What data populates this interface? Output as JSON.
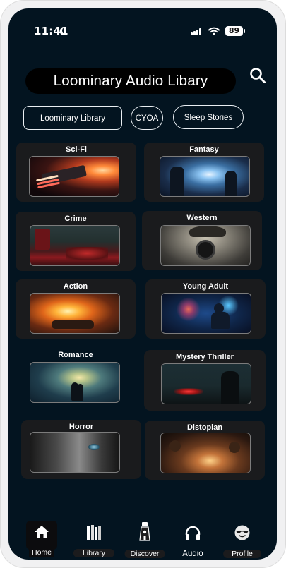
{
  "status_bar": {
    "time": "11:41",
    "battery": "89"
  },
  "header": {
    "title": "Loominary Audio Libary"
  },
  "tabs": [
    {
      "label": "Loominary Library"
    },
    {
      "label": "CYOA"
    },
    {
      "label": "Sleep Stories"
    }
  ],
  "genres": [
    {
      "label": "Sci-Fi"
    },
    {
      "label": "Fantasy"
    },
    {
      "label": "Crime"
    },
    {
      "label": "Western"
    },
    {
      "label": "Action"
    },
    {
      "label": "Young Adult"
    },
    {
      "label": "Romance"
    },
    {
      "label": "Mystery Thriller"
    },
    {
      "label": "Horror"
    },
    {
      "label": "Distopian"
    }
  ],
  "bottom_nav": [
    {
      "label": "Home",
      "icon": "home-icon"
    },
    {
      "label": "Library",
      "icon": "books-icon"
    },
    {
      "label": "Discover",
      "icon": "lighthouse-icon"
    },
    {
      "label": "Audio",
      "icon": "headphones-icon"
    },
    {
      "label": "Profile",
      "icon": "sunglasses-face-icon"
    }
  ],
  "colors": {
    "background": "#031420",
    "card": "#1a1b1d",
    "text": "#ffffff",
    "title_pill": "#000000"
  }
}
